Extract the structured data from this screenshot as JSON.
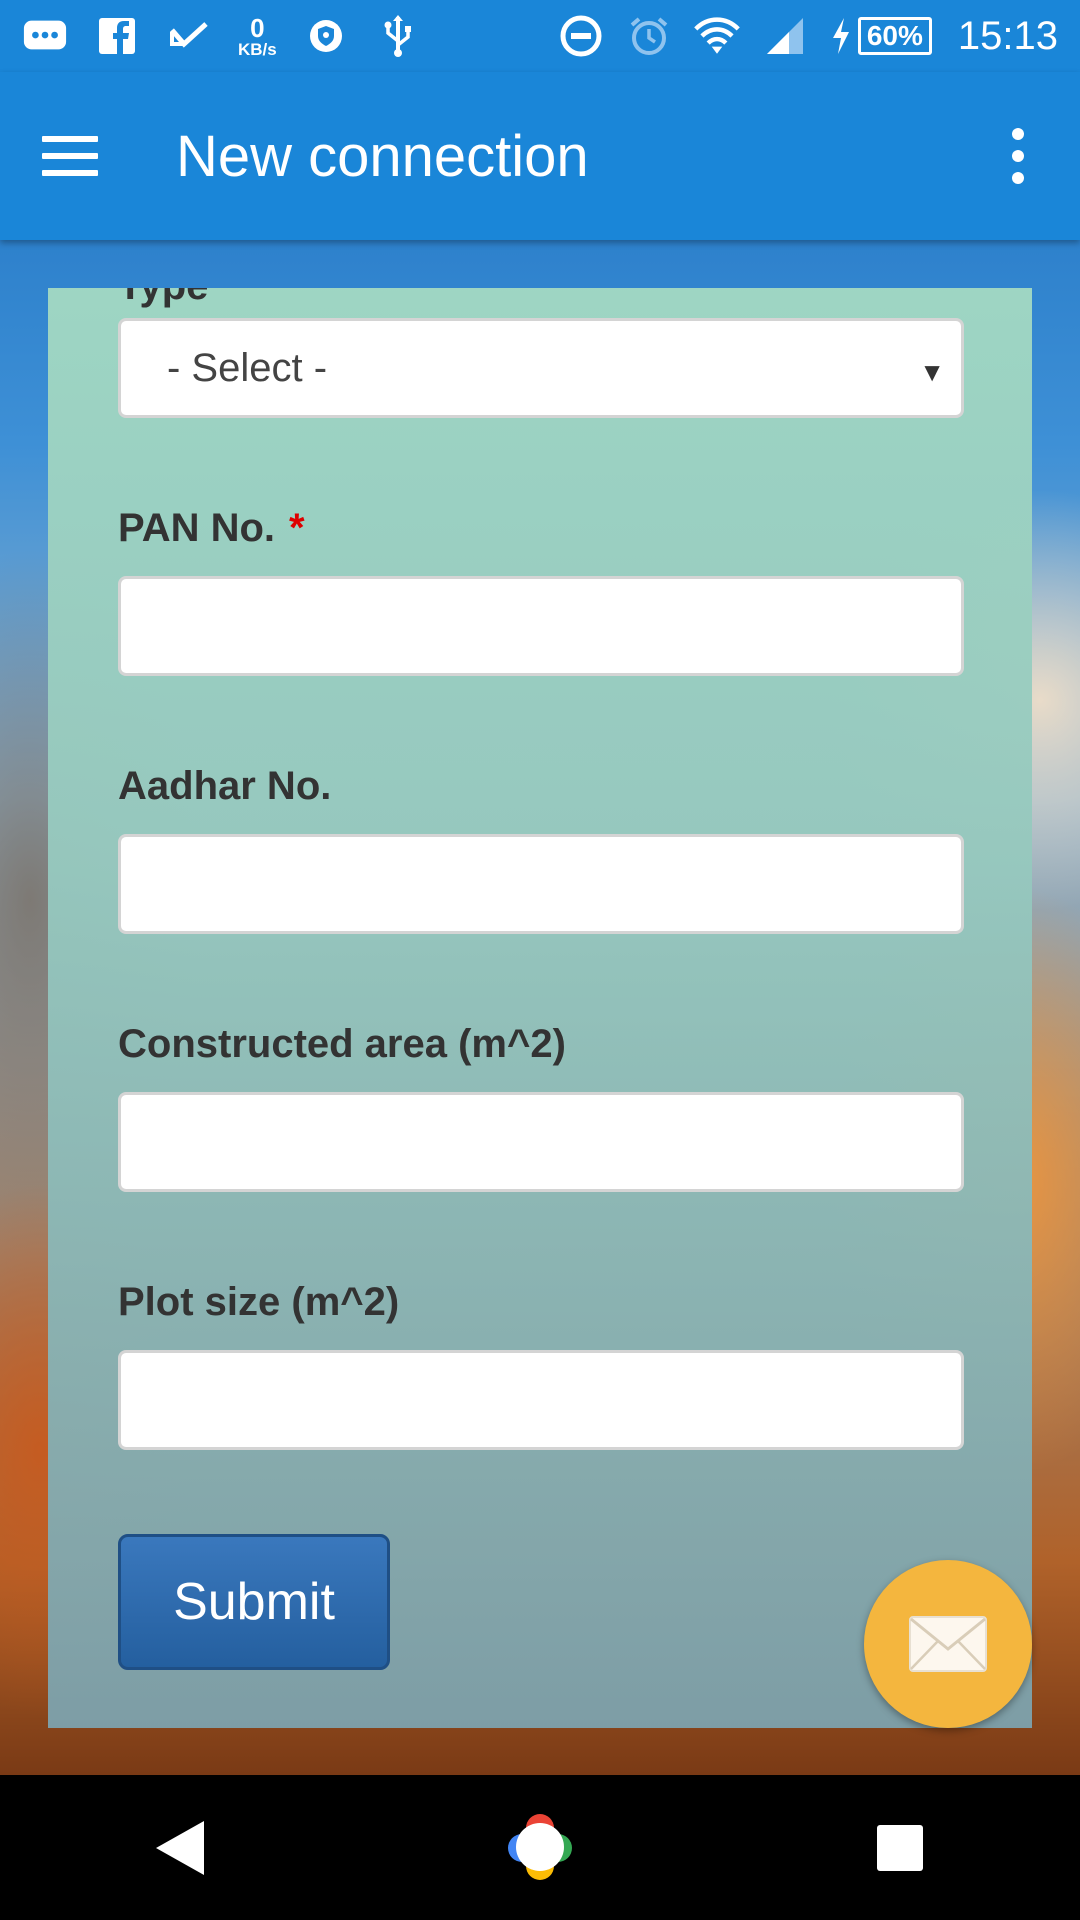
{
  "status_bar": {
    "speed_value": "0",
    "speed_unit": "KB/s",
    "battery": "60%",
    "time": "15:13",
    "icons": [
      "message-icon",
      "facebook-icon",
      "check-download-icon",
      "vpn-shield-icon",
      "usb-icon",
      "dnd-icon",
      "alarm-icon",
      "wifi-icon",
      "signal-icon",
      "charging-icon"
    ]
  },
  "app_bar": {
    "title": "New connection",
    "menu_icon": "hamburger-menu-icon",
    "overflow_icon": "more-vert-icon"
  },
  "form": {
    "partial_label": "Type",
    "select": {
      "value": "- Select -"
    },
    "fields": [
      {
        "label": "PAN No.",
        "required_mark": "*",
        "value": ""
      },
      {
        "label": "Aadhar No.",
        "value": ""
      },
      {
        "label": "Constructed area (m^2)",
        "value": ""
      },
      {
        "label": "Plot size (m^2)",
        "value": ""
      }
    ],
    "submit_label": "Submit"
  },
  "fab": {
    "icon": "envelope-icon",
    "color": "#f4b63e"
  },
  "nav_bar": {
    "icons": [
      "back-icon",
      "home-icon",
      "recents-icon"
    ]
  },
  "colors": {
    "primary": "#1a86d8",
    "button": "#245f9f",
    "required": "#dd0000"
  }
}
